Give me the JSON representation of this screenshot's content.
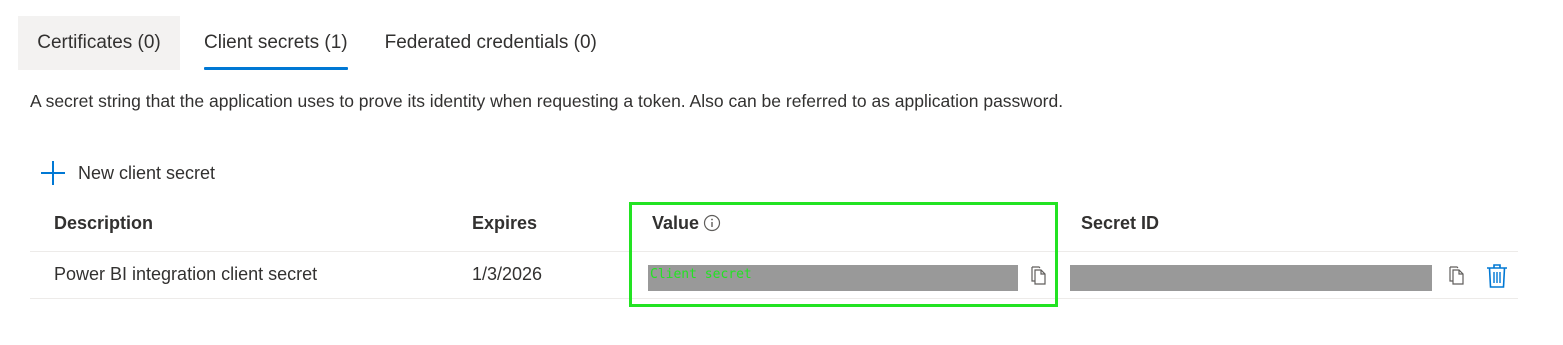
{
  "tabs": [
    {
      "label": "Certificates (0)"
    },
    {
      "label": "Client secrets (1)",
      "active": true
    },
    {
      "label": "Federated credentials (0)"
    }
  ],
  "description": "A secret string that the application uses to prove its identity when requesting a token. Also can be referred to as application password.",
  "toolbar": {
    "new_secret_label": "New client secret"
  },
  "table": {
    "headers": {
      "description": "Description",
      "expires": "Expires",
      "value": "Value",
      "secret_id": "Secret ID"
    },
    "rows": [
      {
        "description": "Power BI integration client secret",
        "expires": "1/3/2026",
        "value_overlay": "Client secret"
      }
    ]
  },
  "colors": {
    "accent": "#0078d4",
    "highlight": "#22e322",
    "redaction": "#999999"
  },
  "icons": {
    "add": "plus-icon",
    "info": "info-icon",
    "copy": "copy-icon",
    "delete": "trash-icon"
  }
}
